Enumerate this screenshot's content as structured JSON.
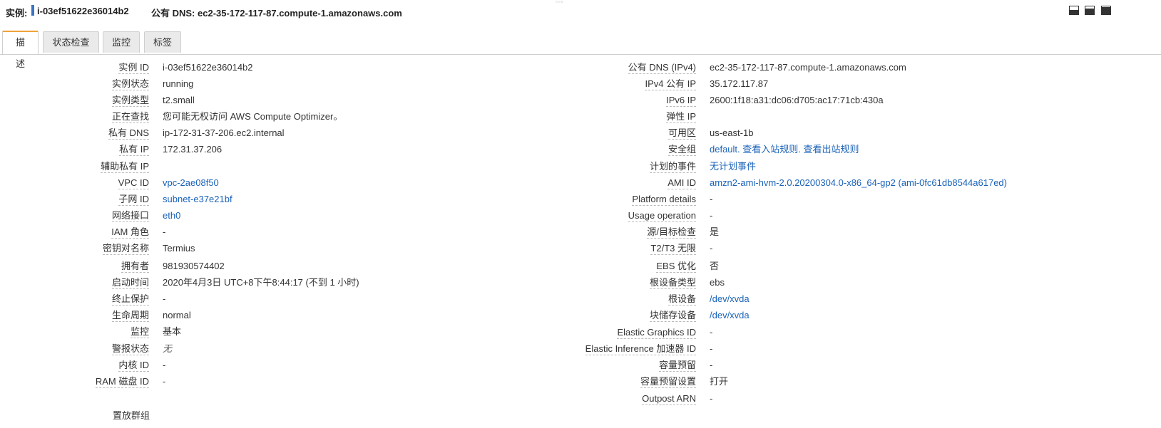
{
  "header": {
    "instance_label": "实例:",
    "instance_id": "i-03ef51622e36014b2",
    "public_dns": "公有 DNS: ec2-35-172-117-87.compute-1.amazonaws.com"
  },
  "window_controls": [
    "panel-bottom-icon",
    "panel-half-icon",
    "panel-full-icon"
  ],
  "tabs": [
    {
      "label": "描述",
      "active": true
    },
    {
      "label": "状态检查",
      "active": false
    },
    {
      "label": "监控",
      "active": false
    },
    {
      "label": "标签",
      "active": false
    }
  ],
  "left": [
    {
      "label": "实例 ID",
      "value": "i-03ef51622e36014b2"
    },
    {
      "label": "实例状态",
      "value": "running"
    },
    {
      "label": "实例类型",
      "value": "t2.small"
    },
    {
      "label": "正在查找",
      "value": "您可能无权访问 AWS Compute Optimizer。"
    },
    {
      "label": "私有 DNS",
      "value": "ip-172-31-37-206.ec2.internal"
    },
    {
      "label": "私有 IP",
      "value": "172.31.37.206"
    },
    {
      "label": "辅助私有 IP",
      "value": ""
    },
    {
      "label": "VPC ID",
      "value": "vpc-2ae08f50"
    },
    {
      "label": "子网 ID",
      "value": "subnet-e37e21bf"
    },
    {
      "label": "网络接口",
      "value": "eth0"
    },
    {
      "label": "IAM 角色",
      "value": "-"
    },
    {
      "label": "密钥对名称",
      "value": "Termius"
    },
    {
      "label": "拥有者",
      "value": "981930574402"
    },
    {
      "label": "启动时间",
      "value": "2020年4月3日 UTC+8下午8:44:17 (不到 1 小时)"
    },
    {
      "label": "终止保护",
      "value": "-"
    },
    {
      "label": "生命周期",
      "value": "normal"
    },
    {
      "label": "监控",
      "value": "基本"
    },
    {
      "label": "警报状态",
      "value": "无"
    },
    {
      "label": "内核 ID",
      "value": "-"
    },
    {
      "label": "RAM 磁盘 ID",
      "value": "-"
    }
  ],
  "right": [
    {
      "label": "公有 DNS (IPv4)",
      "value": "ec2-35-172-117-87.compute-1.amazonaws.com"
    },
    {
      "label": "IPv4 公有 IP",
      "value": "35.172.117.87"
    },
    {
      "label": "IPv6 IP",
      "value": "2600:1f18:a31:dc06:d705:ac17:71cb:430a"
    },
    {
      "label": "弹性 IP",
      "value": ""
    },
    {
      "label": "可用区",
      "value": "us-east-1b"
    },
    {
      "label": "安全组",
      "value": "default.",
      "link1": "查看入站规则",
      "link2": "查看出站规则"
    },
    {
      "label": "计划的事件",
      "value": "无计划事件"
    },
    {
      "label": "AMI ID",
      "value": "amzn2-ami-hvm-2.0.20200304.0-x86_64-gp2 (ami-0fc61db8544a617ed)"
    },
    {
      "label": "Platform details",
      "value": "-"
    },
    {
      "label": "Usage operation",
      "value": "-"
    },
    {
      "label": "源/目标检查",
      "value": "是"
    },
    {
      "label": "T2/T3 无限",
      "value": "-"
    },
    {
      "label": "EBS 优化",
      "value": "否"
    },
    {
      "label": "根设备类型",
      "value": "ebs"
    },
    {
      "label": "根设备",
      "value": "/dev/xvda"
    },
    {
      "label": "块储存设备",
      "value": "/dev/xvda"
    },
    {
      "label": "Elastic Graphics ID",
      "value": "-"
    },
    {
      "label": "Elastic Inference 加速器 ID",
      "value": "-"
    },
    {
      "label": "容量预留",
      "value": "-"
    },
    {
      "label": "容量预留设置",
      "value": "打开"
    },
    {
      "label": "Outpost ARN",
      "value": "-"
    }
  ],
  "cut_off_label": "置放群组"
}
